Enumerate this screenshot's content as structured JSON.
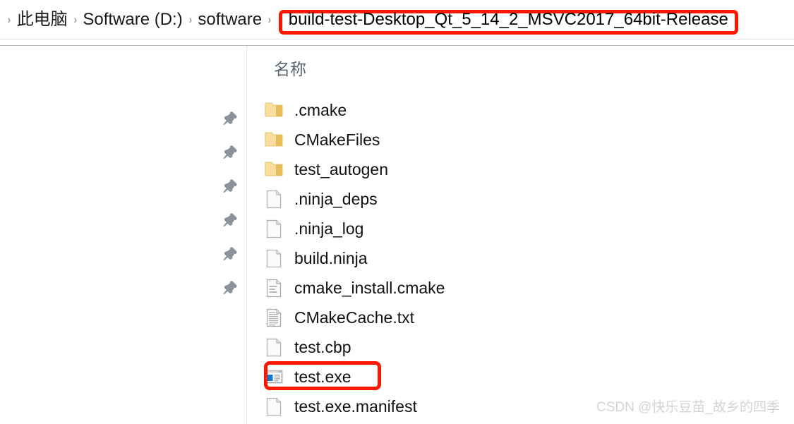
{
  "window": {
    "kind": "file-explorer"
  },
  "breadcrumb": {
    "separator": "›",
    "items": [
      {
        "label": "此电脑"
      },
      {
        "label": "Software (D:)"
      },
      {
        "label": "software"
      }
    ],
    "current": "build-test-Desktop_Qt_5_14_2_MSVC2017_64bit-Release",
    "current_highlighted": true,
    "highlight_color": "#fb1800"
  },
  "toolbar": {
    "collapse_icon": "chevron-up-icon"
  },
  "left_pane": {
    "pin_icon": "pin-icon",
    "pin_count": 6
  },
  "file_list": {
    "columns": [
      {
        "key": "name",
        "label": "名称"
      }
    ],
    "rows": [
      {
        "name": ".cmake",
        "icon": "folder-icon",
        "highlighted": false
      },
      {
        "name": "CMakeFiles",
        "icon": "folder-icon",
        "highlighted": false
      },
      {
        "name": "test_autogen",
        "icon": "folder-icon",
        "highlighted": false
      },
      {
        "name": ".ninja_deps",
        "icon": "blank-file-icon",
        "highlighted": false
      },
      {
        "name": ".ninja_log",
        "icon": "blank-file-icon",
        "highlighted": false
      },
      {
        "name": "build.ninja",
        "icon": "blank-file-icon",
        "highlighted": false
      },
      {
        "name": "cmake_install.cmake",
        "icon": "script-file-icon",
        "highlighted": false
      },
      {
        "name": "CMakeCache.txt",
        "icon": "text-file-icon",
        "highlighted": false
      },
      {
        "name": "test.cbp",
        "icon": "blank-file-icon",
        "highlighted": false
      },
      {
        "name": "test.exe",
        "icon": "application-icon",
        "highlighted": true
      },
      {
        "name": "test.exe.manifest",
        "icon": "blank-file-icon",
        "highlighted": false
      }
    ]
  },
  "watermark": {
    "text": "CSDN @快乐豆苗_故乡的四季"
  },
  "colors": {
    "highlight": "#fb1800",
    "folder": "#f2cb69",
    "app_accent": "#0078d7",
    "header_text": "#5a6572"
  }
}
